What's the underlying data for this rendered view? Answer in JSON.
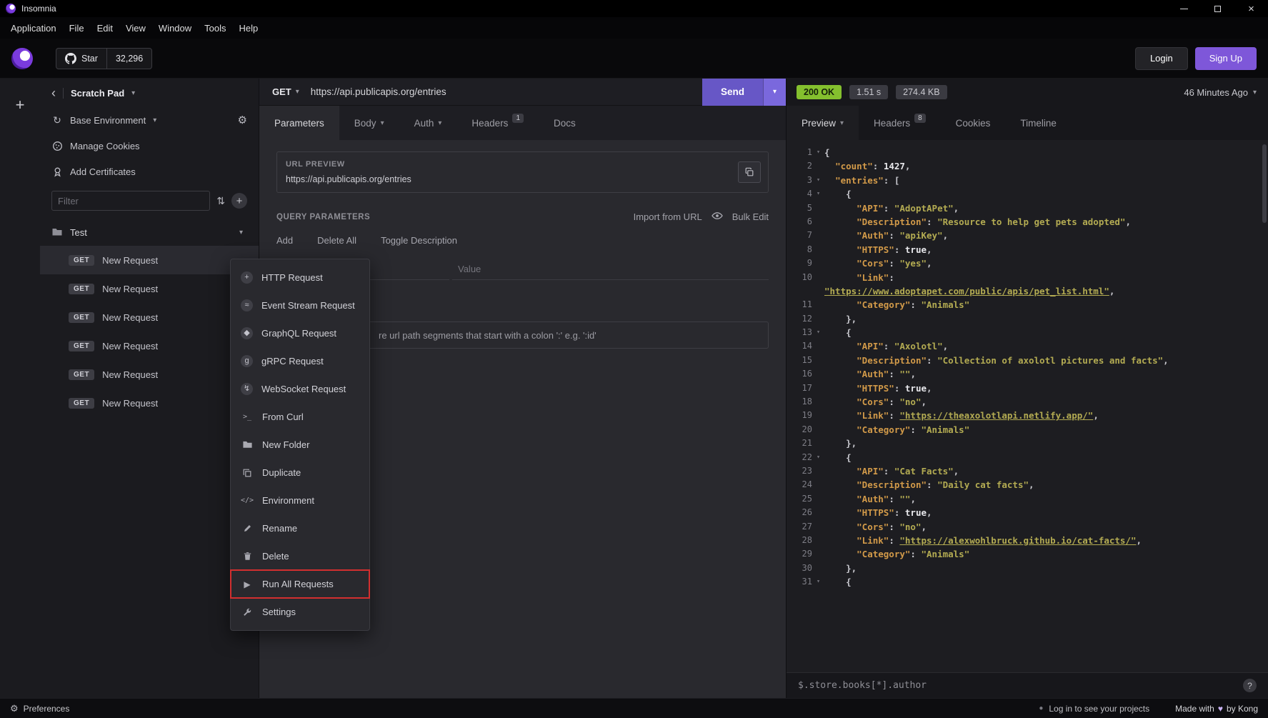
{
  "colors": {
    "accent": "#6757c6",
    "accent_bright": "#7e57d9",
    "status_green": "#84c02e",
    "annotation_red": "#d22f2f",
    "json_key": "#d29a49",
    "json_string": "#b3ab52"
  },
  "titlebar": {
    "app_name": "Insomnia"
  },
  "menubar": {
    "items": [
      "Application",
      "File",
      "Edit",
      "View",
      "Window",
      "Tools",
      "Help"
    ]
  },
  "header": {
    "star_label": "Star",
    "star_count": "32,296",
    "login_label": "Login",
    "signup_label": "Sign Up"
  },
  "sidebar": {
    "workspace_name": "Scratch Pad",
    "environment_label": "Base Environment",
    "manage_cookies_label": "Manage Cookies",
    "add_certificates_label": "Add Certificates",
    "filter_placeholder": "Filter",
    "folder_name": "Test",
    "requests": [
      {
        "method": "GET",
        "name": "New Request",
        "selected": true
      },
      {
        "method": "GET",
        "name": "New Request"
      },
      {
        "method": "GET",
        "name": "New Request"
      },
      {
        "method": "GET",
        "name": "New Request"
      },
      {
        "method": "GET",
        "name": "New Request"
      },
      {
        "method": "GET",
        "name": "New Request"
      }
    ]
  },
  "request_pane": {
    "method": "GET",
    "url": "https://api.publicapis.org/entries",
    "send_label": "Send",
    "tabs": [
      {
        "label": "Parameters",
        "active": true
      },
      {
        "label": "Body",
        "caret": true
      },
      {
        "label": "Auth",
        "caret": true
      },
      {
        "label": "Headers",
        "badge": "1"
      },
      {
        "label": "Docs"
      }
    ],
    "url_preview_label": "URL PREVIEW",
    "url_preview": "https://api.publicapis.org/entries",
    "query_label": "QUERY PARAMETERS",
    "import_from_url_label": "Import from URL",
    "bulk_edit_label": "Bulk Edit",
    "actions": [
      "Add",
      "Delete All",
      "Toggle Description"
    ],
    "value_placeholder": "Value",
    "path_note": "re url path segments that start with a colon ':' e.g. ':id'"
  },
  "context_menu": {
    "items": [
      {
        "icon": "plus-circle-icon",
        "label": "HTTP Request"
      },
      {
        "icon": "stream-icon",
        "label": "Event Stream Request"
      },
      {
        "icon": "graphql-icon",
        "label": "GraphQL Request"
      },
      {
        "icon": "grpc-icon",
        "label": "gRPC Request"
      },
      {
        "icon": "websocket-icon",
        "label": "WebSocket Request"
      },
      {
        "icon": "terminal-icon",
        "label": "From Curl"
      },
      {
        "icon": "folder-icon",
        "label": "New Folder"
      },
      {
        "icon": "duplicate-icon",
        "label": "Duplicate"
      },
      {
        "icon": "code-icon",
        "label": "Environment"
      },
      {
        "icon": "rename-icon",
        "label": "Rename"
      },
      {
        "icon": "trash-icon",
        "label": "Delete"
      },
      {
        "icon": "play-icon",
        "label": "Run All Requests",
        "annotated": true
      },
      {
        "icon": "wrench-icon",
        "label": "Settings"
      }
    ]
  },
  "response_pane": {
    "status": "200 OK",
    "duration": "1.51 s",
    "size": "274.4 KB",
    "age": "46 Minutes Ago",
    "tabs": [
      {
        "label": "Preview",
        "caret": true,
        "active": true
      },
      {
        "label": "Headers",
        "badge": "8"
      },
      {
        "label": "Cookies"
      },
      {
        "label": "Timeline"
      }
    ],
    "jsonpath_value": "$.store.books[*].author",
    "body_lines": [
      {
        "n": "1",
        "fold": true,
        "t": [
          [
            "p",
            "{"
          ]
        ]
      },
      {
        "n": "2",
        "t": [
          [
            "w",
            "  "
          ],
          [
            "k",
            "\"count\""
          ],
          [
            "p",
            ": "
          ],
          [
            "num",
            "1427"
          ],
          [
            "p",
            ","
          ]
        ]
      },
      {
        "n": "3",
        "fold": true,
        "t": [
          [
            "w",
            "  "
          ],
          [
            "k",
            "\"entries\""
          ],
          [
            "p",
            ": ["
          ]
        ]
      },
      {
        "n": "4",
        "fold": true,
        "t": [
          [
            "w",
            "    "
          ],
          [
            "p",
            "{"
          ]
        ]
      },
      {
        "n": "5",
        "t": [
          [
            "w",
            "      "
          ],
          [
            "k",
            "\"API\""
          ],
          [
            "p",
            ": "
          ],
          [
            "s",
            "\"AdoptAPet\""
          ],
          [
            "p",
            ","
          ]
        ]
      },
      {
        "n": "6",
        "t": [
          [
            "w",
            "      "
          ],
          [
            "k",
            "\"Description\""
          ],
          [
            "p",
            ": "
          ],
          [
            "s",
            "\"Resource to help get pets adopted\""
          ],
          [
            "p",
            ","
          ]
        ]
      },
      {
        "n": "7",
        "t": [
          [
            "w",
            "      "
          ],
          [
            "k",
            "\"Auth\""
          ],
          [
            "p",
            ": "
          ],
          [
            "s",
            "\"apiKey\""
          ],
          [
            "p",
            ","
          ]
        ]
      },
      {
        "n": "8",
        "t": [
          [
            "w",
            "      "
          ],
          [
            "k",
            "\"HTTPS\""
          ],
          [
            "p",
            ": "
          ],
          [
            "b",
            "true"
          ],
          [
            "p",
            ","
          ]
        ]
      },
      {
        "n": "9",
        "t": [
          [
            "w",
            "      "
          ],
          [
            "k",
            "\"Cors\""
          ],
          [
            "p",
            ": "
          ],
          [
            "s",
            "\"yes\""
          ],
          [
            "p",
            ","
          ]
        ]
      },
      {
        "n": "10",
        "t": [
          [
            "w",
            "      "
          ],
          [
            "k",
            "\"Link\""
          ],
          [
            "p",
            ":"
          ]
        ]
      },
      {
        "n": "",
        "t": [
          [
            "u",
            "\"https://www.adoptapet.com/public/apis/pet_list.html\""
          ],
          [
            "p",
            ","
          ]
        ]
      },
      {
        "n": "11",
        "t": [
          [
            "w",
            "      "
          ],
          [
            "k",
            "\"Category\""
          ],
          [
            "p",
            ": "
          ],
          [
            "s",
            "\"Animals\""
          ]
        ]
      },
      {
        "n": "12",
        "t": [
          [
            "w",
            "    "
          ],
          [
            "p",
            "},"
          ]
        ]
      },
      {
        "n": "13",
        "fold": true,
        "t": [
          [
            "w",
            "    "
          ],
          [
            "p",
            "{"
          ]
        ]
      },
      {
        "n": "14",
        "t": [
          [
            "w",
            "      "
          ],
          [
            "k",
            "\"API\""
          ],
          [
            "p",
            ": "
          ],
          [
            "s",
            "\"Axolotl\""
          ],
          [
            "p",
            ","
          ]
        ]
      },
      {
        "n": "15",
        "t": [
          [
            "w",
            "      "
          ],
          [
            "k",
            "\"Description\""
          ],
          [
            "p",
            ": "
          ],
          [
            "s",
            "\"Collection of axolotl pictures and facts\""
          ],
          [
            "p",
            ","
          ]
        ]
      },
      {
        "n": "16",
        "t": [
          [
            "w",
            "      "
          ],
          [
            "k",
            "\"Auth\""
          ],
          [
            "p",
            ": "
          ],
          [
            "s",
            "\"\""
          ],
          [
            "p",
            ","
          ]
        ]
      },
      {
        "n": "17",
        "t": [
          [
            "w",
            "      "
          ],
          [
            "k",
            "\"HTTPS\""
          ],
          [
            "p",
            ": "
          ],
          [
            "b",
            "true"
          ],
          [
            "p",
            ","
          ]
        ]
      },
      {
        "n": "18",
        "t": [
          [
            "w",
            "      "
          ],
          [
            "k",
            "\"Cors\""
          ],
          [
            "p",
            ": "
          ],
          [
            "s",
            "\"no\""
          ],
          [
            "p",
            ","
          ]
        ]
      },
      {
        "n": "19",
        "t": [
          [
            "w",
            "      "
          ],
          [
            "k",
            "\"Link\""
          ],
          [
            "p",
            ": "
          ],
          [
            "u",
            "\"https://theaxolotlapi.netlify.app/\""
          ],
          [
            "p",
            ","
          ]
        ]
      },
      {
        "n": "20",
        "t": [
          [
            "w",
            "      "
          ],
          [
            "k",
            "\"Category\""
          ],
          [
            "p",
            ": "
          ],
          [
            "s",
            "\"Animals\""
          ]
        ]
      },
      {
        "n": "21",
        "t": [
          [
            "w",
            "    "
          ],
          [
            "p",
            "},"
          ]
        ]
      },
      {
        "n": "22",
        "fold": true,
        "t": [
          [
            "w",
            "    "
          ],
          [
            "p",
            "{"
          ]
        ]
      },
      {
        "n": "23",
        "t": [
          [
            "w",
            "      "
          ],
          [
            "k",
            "\"API\""
          ],
          [
            "p",
            ": "
          ],
          [
            "s",
            "\"Cat Facts\""
          ],
          [
            "p",
            ","
          ]
        ]
      },
      {
        "n": "24",
        "t": [
          [
            "w",
            "      "
          ],
          [
            "k",
            "\"Description\""
          ],
          [
            "p",
            ": "
          ],
          [
            "s",
            "\"Daily cat facts\""
          ],
          [
            "p",
            ","
          ]
        ]
      },
      {
        "n": "25",
        "t": [
          [
            "w",
            "      "
          ],
          [
            "k",
            "\"Auth\""
          ],
          [
            "p",
            ": "
          ],
          [
            "s",
            "\"\""
          ],
          [
            "p",
            ","
          ]
        ]
      },
      {
        "n": "26",
        "t": [
          [
            "w",
            "      "
          ],
          [
            "k",
            "\"HTTPS\""
          ],
          [
            "p",
            ": "
          ],
          [
            "b",
            "true"
          ],
          [
            "p",
            ","
          ]
        ]
      },
      {
        "n": "27",
        "t": [
          [
            "w",
            "      "
          ],
          [
            "k",
            "\"Cors\""
          ],
          [
            "p",
            ": "
          ],
          [
            "s",
            "\"no\""
          ],
          [
            "p",
            ","
          ]
        ]
      },
      {
        "n": "28",
        "t": [
          [
            "w",
            "      "
          ],
          [
            "k",
            "\"Link\""
          ],
          [
            "p",
            ": "
          ],
          [
            "u",
            "\"https://alexwohlbruck.github.io/cat-facts/\""
          ],
          [
            "p",
            ","
          ]
        ]
      },
      {
        "n": "29",
        "t": [
          [
            "w",
            "      "
          ],
          [
            "k",
            "\"Category\""
          ],
          [
            "p",
            ": "
          ],
          [
            "s",
            "\"Animals\""
          ]
        ]
      },
      {
        "n": "30",
        "t": [
          [
            "w",
            "    "
          ],
          [
            "p",
            "},"
          ]
        ]
      },
      {
        "n": "31",
        "fold": true,
        "t": [
          [
            "w",
            "    "
          ],
          [
            "p",
            "{"
          ]
        ]
      }
    ]
  },
  "statusbar": {
    "preferences_label": "Preferences",
    "login_hint": "Log in to see your projects",
    "made_with_prefix": "Made with",
    "made_with_suffix": "by Kong"
  }
}
